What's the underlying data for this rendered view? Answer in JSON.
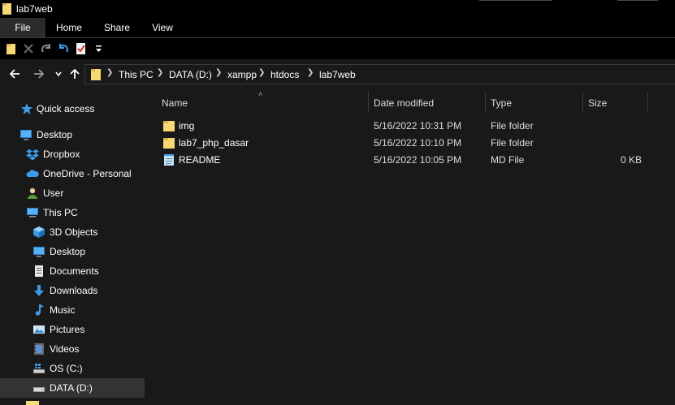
{
  "window": {
    "title": "lab7web"
  },
  "ribbon": {
    "tabs": [
      {
        "label": "File"
      },
      {
        "label": "Home"
      },
      {
        "label": "Share"
      },
      {
        "label": "View"
      }
    ]
  },
  "quick_access_toolbar": {
    "icons": [
      "folder-icon",
      "delete-icon",
      "redo-icon",
      "undo-icon",
      "properties-icon",
      "customize-dropdown-icon"
    ]
  },
  "nav": {
    "back_icon": "back-arrow-icon",
    "forward_icon": "forward-arrow-icon",
    "recent_icon": "chevron-down-icon",
    "up_icon": "up-arrow-icon",
    "breadcrumb": [
      "This PC",
      "DATA (D:)",
      "xampp",
      "htdocs",
      "lab7web"
    ]
  },
  "sidebar": {
    "items": [
      {
        "label": "Quick access",
        "icon": "star-icon"
      },
      {
        "label": "Desktop",
        "icon": "desktop-icon"
      },
      {
        "label": "Dropbox",
        "icon": "dropbox-icon"
      },
      {
        "label": "OneDrive - Personal",
        "icon": "cloud-icon"
      },
      {
        "label": "User",
        "icon": "user-icon"
      },
      {
        "label": "This PC",
        "icon": "computer-icon"
      },
      {
        "label": "3D Objects",
        "icon": "cube-icon"
      },
      {
        "label": "Desktop",
        "icon": "desktop-icon"
      },
      {
        "label": "Documents",
        "icon": "document-icon"
      },
      {
        "label": "Downloads",
        "icon": "download-icon"
      },
      {
        "label": "Music",
        "icon": "music-icon"
      },
      {
        "label": "Pictures",
        "icon": "picture-icon"
      },
      {
        "label": "Videos",
        "icon": "video-icon"
      },
      {
        "label": "OS (C:)",
        "icon": "windows-drive-icon"
      },
      {
        "label": "DATA (D:)",
        "icon": "drive-icon"
      }
    ]
  },
  "columns": [
    {
      "label": "Name"
    },
    {
      "label": "Date modified"
    },
    {
      "label": "Type"
    },
    {
      "label": "Size"
    }
  ],
  "files": [
    {
      "name": "img",
      "date": "5/16/2022 10:31 PM",
      "type": "File folder",
      "size": "",
      "icon": "folder-icon"
    },
    {
      "name": "lab7_php_dasar",
      "date": "5/16/2022 10:10 PM",
      "type": "File folder",
      "size": "",
      "icon": "folder-icon"
    },
    {
      "name": "README",
      "date": "5/16/2022 10:05 PM",
      "type": "MD File",
      "size": "0 KB",
      "icon": "notepad-file-icon"
    }
  ],
  "colors": {
    "folder": "#F8D775",
    "accent_blue": "#3C9BE8",
    "background": "#191919",
    "selected": "#333333"
  }
}
